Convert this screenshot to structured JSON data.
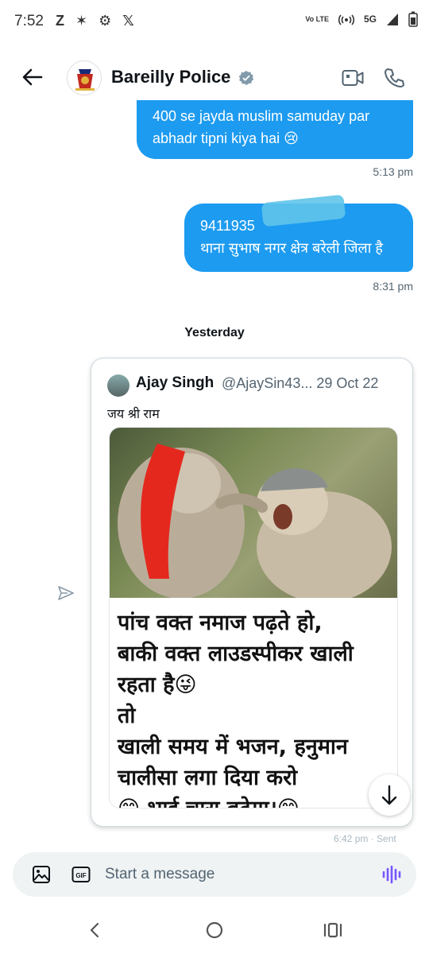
{
  "status_bar": {
    "time": "7:52",
    "left_icons": [
      "Z",
      "✶",
      "⚙",
      "𝕏"
    ],
    "volte": "Vo LTE",
    "network": "5G",
    "icons": [
      "volte-icon",
      "hotspot-icon",
      "signal-icon",
      "battery-icon"
    ]
  },
  "header": {
    "title": "Bareilly Police",
    "verified": true,
    "accent": "#1d9bf0"
  },
  "messages": [
    {
      "text": "400 se jayda muslim samuday par abhadr tipni kiya hai 😢",
      "time": "5:13 pm",
      "direction": "outgoing"
    },
    {
      "text_line1": "9411935",
      "text_line2": "थाना सुभाष नगर क्षेत्र बरेली जिला है",
      "time": "8:31 pm",
      "direction": "outgoing"
    }
  ],
  "day_separator": "Yesterday",
  "quoted_tweet": {
    "author": "Ajay Singh",
    "handle_date": "@AjaySin43... 29 Oct 22",
    "text": "जय श्री राम",
    "meme_lines": [
      "पांच वक्त नमाज पढ़ते हो,",
      "बाकी वक्त लाउडस्पीकर खाली",
      "रहता है😜",
      "तो",
      "खाली समय में भजन, हनुमान",
      "चालीसा लगा दिया करो",
      "😊 भाई चारा बढ़ेगा।😊"
    ],
    "partial_timestamp": "6:42 pm · Sent"
  },
  "composer": {
    "placeholder": "Start a message"
  },
  "colors": {
    "bubble": "#1d9bf0",
    "voice_icon": "#7856ff"
  }
}
